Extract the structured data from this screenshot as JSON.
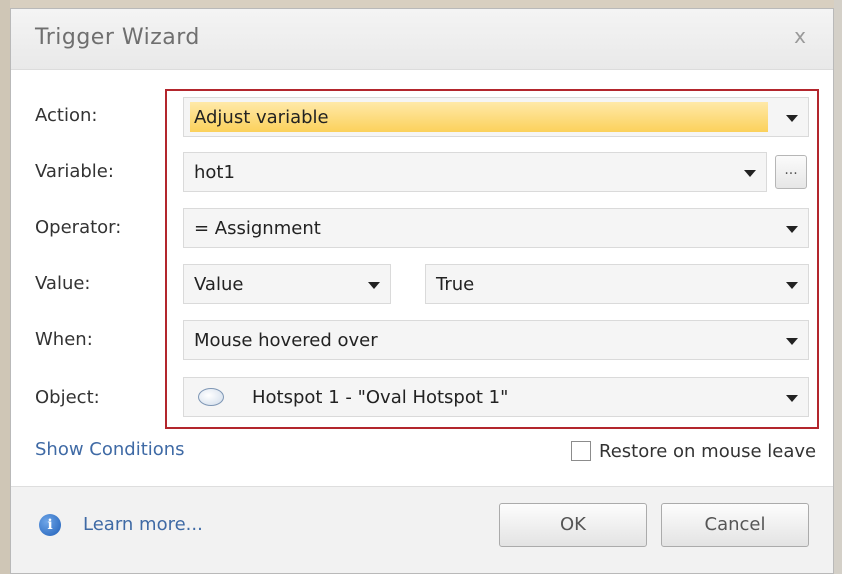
{
  "dialog": {
    "title": "Trigger Wizard",
    "close_glyph": "x"
  },
  "form": {
    "action_label": "Action:",
    "action_value": "Adjust variable",
    "variable_label": "Variable:",
    "variable_value": "hot1",
    "variable_browse_label": "...",
    "operator_label": "Operator:",
    "operator_value": "= Assignment",
    "value_label": "Value:",
    "value_type": "Value",
    "value_value": "True",
    "when_label": "When:",
    "when_value": "Mouse hovered over",
    "object_label": "Object:",
    "object_value": "Hotspot 1 - \"Oval Hotspot 1\"",
    "object_icon": "oval-hotspot-icon"
  },
  "options": {
    "show_conditions": "Show Conditions",
    "restore_label": "Restore on mouse leave",
    "restore_checked": false
  },
  "footer": {
    "learn_more": "Learn more...",
    "ok": "OK",
    "cancel": "Cancel",
    "info_icon": "info-icon"
  },
  "colors": {
    "highlight_box": "#b3262d",
    "selected_fill": "#fbd15b",
    "link": "#3f6aa5"
  }
}
